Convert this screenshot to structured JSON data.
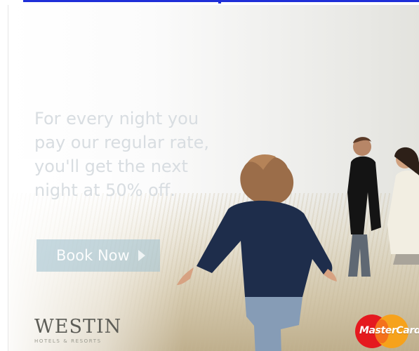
{
  "ad": {
    "headline_lines": [
      "For every night you",
      "pay our regular rate,",
      "you'll get the next",
      "night at 50% off."
    ],
    "cta_label": "Book Now",
    "brand": {
      "wordmark": "WESTIN",
      "tagline": "HOTELS & RESORTS"
    },
    "partner_logo_text": "MasterCard"
  },
  "colors": {
    "headline": "#d8dde1",
    "button_bg": "#a4c4d1",
    "mastercard_red": "#e5191f",
    "mastercard_orange": "#f7a11a"
  },
  "icons": {
    "button_arrow": "play-icon"
  }
}
